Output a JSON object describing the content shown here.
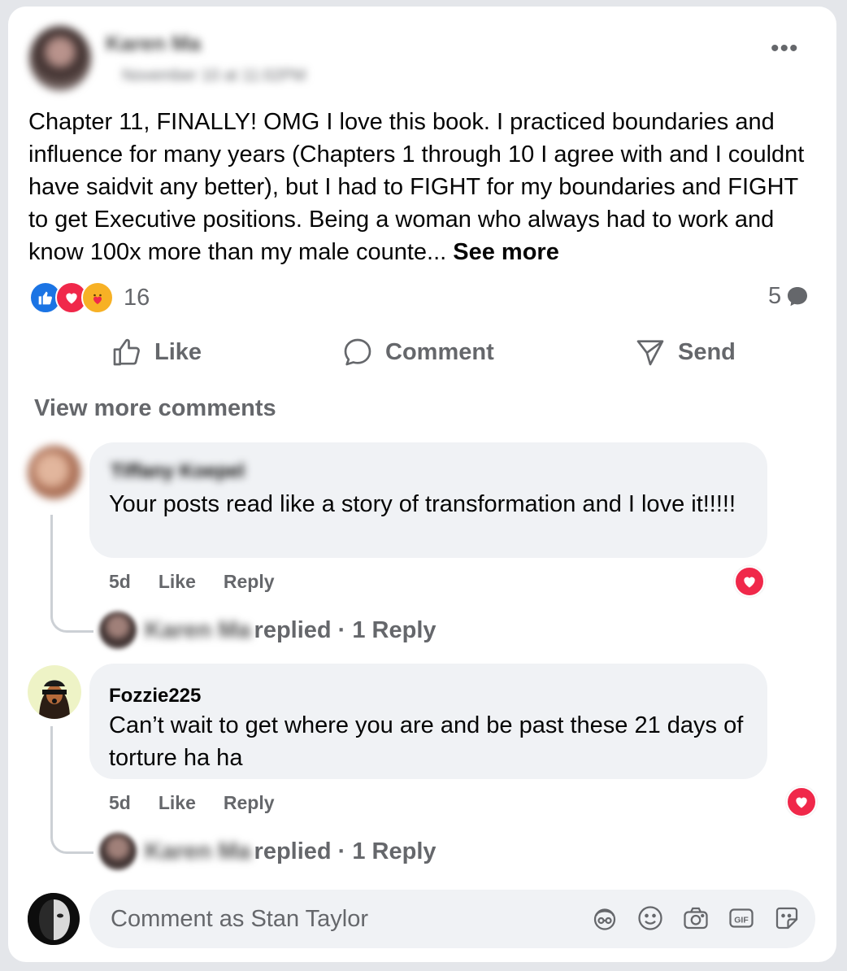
{
  "post": {
    "author_name": "Karen Ma",
    "date": "November 10 at 11:02PM",
    "text": "Chapter 11, FINALLY! OMG I love this book. I practiced boundaries and influence for many years (Chapters 1 through 10 I agree with and I couldnt have saidvit any better), but I had to FIGHT for my boundaries and FIGHT to get Executive positions. Being a woman who always had to work and know 100x more than my male counte...",
    "see_more": "See more",
    "reaction_count": "16",
    "comment_count": "5",
    "reaction_icons": [
      "like-icon",
      "love-icon",
      "care-icon"
    ]
  },
  "actions": {
    "like": "Like",
    "comment": "Comment",
    "send": "Send"
  },
  "view_more_comments": "View more comments",
  "comments": [
    {
      "author": "Tiffany Koepel",
      "text": "Your posts read like a story of transformation and I love it!!!!!",
      "time": "5d",
      "like": "Like",
      "reply": "Reply",
      "reply_author": "Karen Ma",
      "replied": "replied",
      "reply_count": "· 1 Reply"
    },
    {
      "author": "Fozzie225",
      "text": "Can’t wait to get where you are and be past these 21 days of torture ha ha",
      "time": "5d",
      "like": "Like",
      "reply": "Reply",
      "reply_author": "Karen Ma",
      "replied": "replied",
      "reply_count": "· 1 Reply"
    }
  ],
  "composer": {
    "placeholder": "Comment as Stan Taylor",
    "tools": [
      "avatar-sticker-icon",
      "emoji-icon",
      "camera-icon",
      "gif-icon",
      "sticker-icon"
    ]
  },
  "colors": {
    "like_blue": "#1b74e4",
    "love_red": "#f0284a",
    "care_yellow": "#f7b125",
    "secondary_text": "#65676b",
    "bubble_bg": "#f0f2f5"
  }
}
